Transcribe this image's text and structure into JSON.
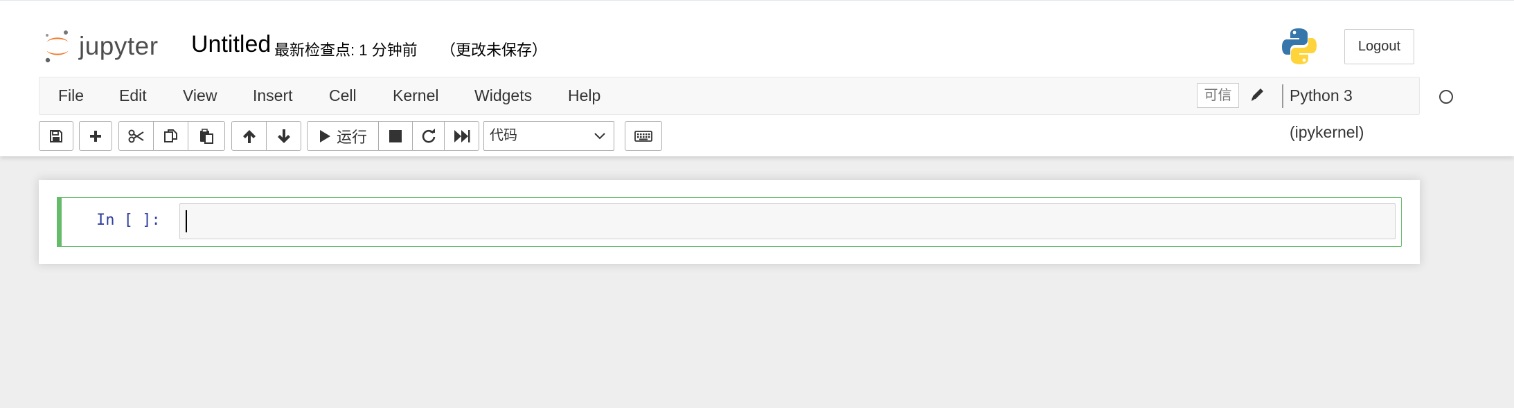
{
  "header": {
    "logo_text": "jupyter",
    "notebook_title": "Untitled",
    "checkpoint": "最新检查点: 1 分钟前",
    "autosave_status": "（更改未保存）",
    "logout_label": "Logout"
  },
  "menubar": {
    "items": [
      "File",
      "Edit",
      "View",
      "Insert",
      "Cell",
      "Kernel",
      "Widgets",
      "Help"
    ],
    "trusted_label": "可信",
    "kernel_name": "Python 3 (ipykernel)"
  },
  "toolbar": {
    "run_label": "运行",
    "cell_type": "代码",
    "icons": [
      "save-icon",
      "plus-icon",
      "scissors-icon",
      "copy-icon",
      "paste-icon",
      "arrow-up-icon",
      "arrow-down-icon",
      "play-icon",
      "stop-icon",
      "restart-icon",
      "fast-forward-icon",
      "keyboard-icon"
    ]
  },
  "cell": {
    "prompt": "In [ ]:",
    "source": ""
  },
  "colors": {
    "cell_selected_border": "#66bb6a",
    "prompt_color": "#303f9f",
    "jupyter_orange": "#f37726"
  }
}
